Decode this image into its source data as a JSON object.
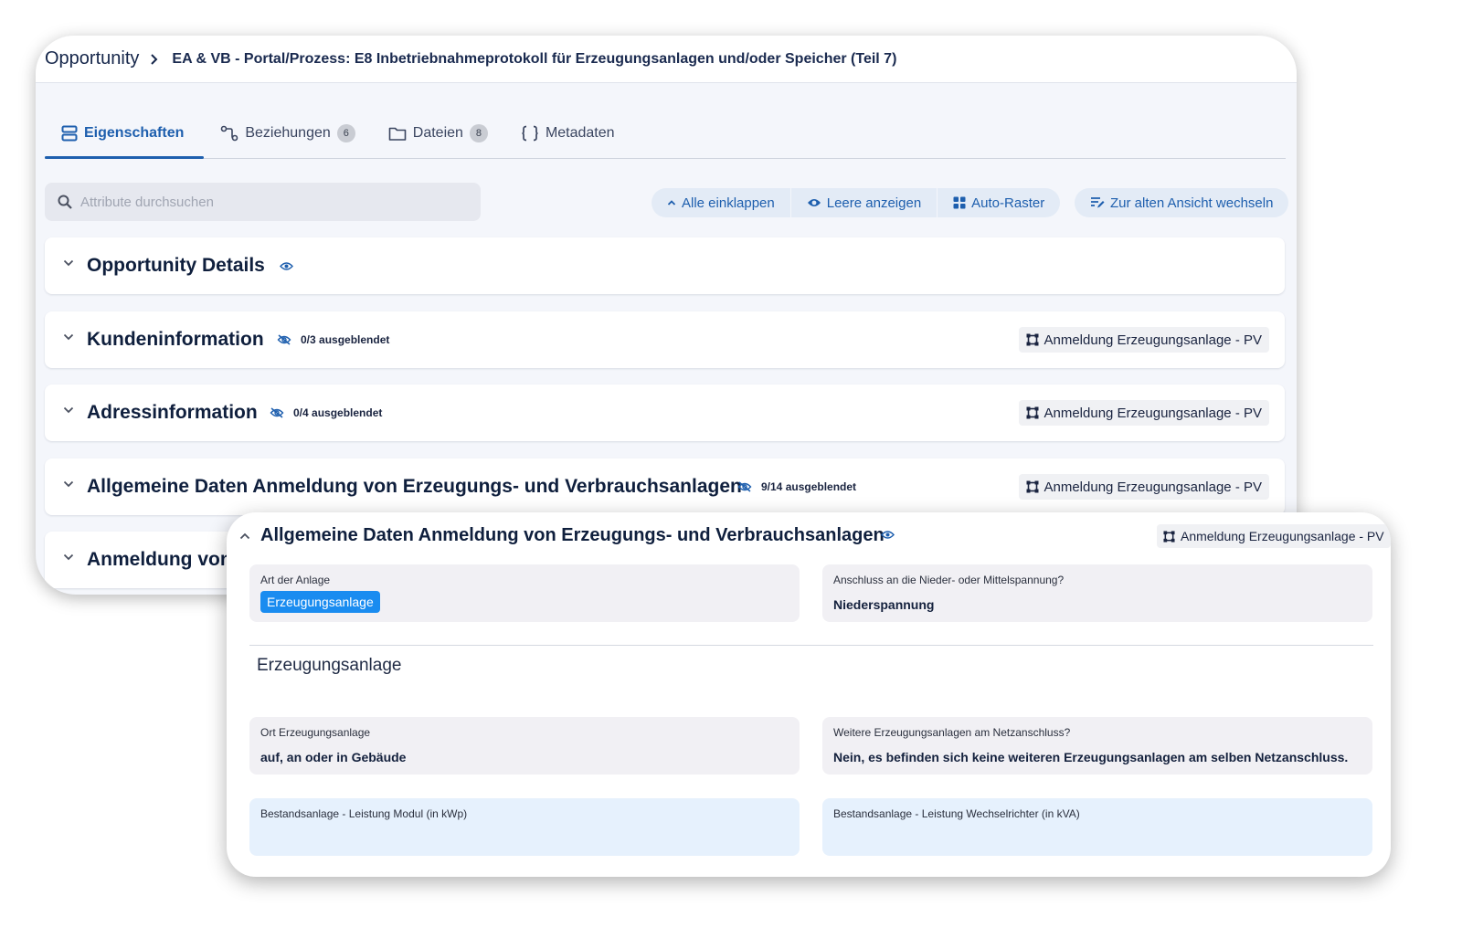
{
  "breadcrumb": {
    "root": "Opportunity",
    "current": "EA & VB - Portal/Prozess: E8 Inbetriebnahmeprotokoll für Erzeugungsanlagen und/oder Speicher (Teil 7)"
  },
  "tabs": [
    {
      "label": "Eigenschaften",
      "icon": "properties-icon",
      "active": true
    },
    {
      "label": "Beziehungen",
      "icon": "relations-icon",
      "badge": "6"
    },
    {
      "label": "Dateien",
      "icon": "folder-icon",
      "badge": "8"
    },
    {
      "label": "Metadaten",
      "icon": "braces-icon"
    }
  ],
  "search": {
    "placeholder": "Attribute durchsuchen"
  },
  "toolbar": {
    "collapse_all": "Alle einklappen",
    "show_empty": "Leere anzeigen",
    "auto_grid": "Auto-Raster",
    "switch_view": "Zur alten Ansicht wechseln"
  },
  "sections": [
    {
      "title": "Opportunity Details",
      "hidden": "",
      "tag": ""
    },
    {
      "title": "Kundeninformation",
      "hidden": "0/3 ausgeblendet",
      "tag": "Anmeldung Erzeugungsanlage - PV"
    },
    {
      "title": "Adressinformation",
      "hidden": "0/4 ausgeblendet",
      "tag": "Anmeldung Erzeugungsanlage - PV"
    },
    {
      "title": "Allgemeine Daten Anmeldung von Erzeugungs- und Verbrauchsanlagen",
      "hidden": "9/14 ausgeblendet",
      "tag": "Anmeldung Erzeugungsanlage - PV"
    },
    {
      "title": "Anmeldung von"
    }
  ],
  "detail": {
    "title": "Allgemeine Daten Anmeldung von Erzeugungs- und Verbrauchsanlagen",
    "tag": "Anmeldung Erzeugungsanlage - PV",
    "fields": {
      "art_label": "Art der Anlage",
      "art_value": "Erzeugungsanlage",
      "anschluss_label": "Anschluss an die Nieder- oder Mittelspannung?",
      "anschluss_value": "Niederspannung",
      "ort_label": "Ort Erzeugungsanlage",
      "ort_value": "auf, an oder in Gebäude",
      "weitere_label": "Weitere Erzeugungsanlagen am Netzanschluss?",
      "weitere_value": "Nein, es befinden sich keine weiteren Erzeugungsanlagen am selben Netzanschluss.",
      "modul_label": "Bestandsanlage - Leistung Modul (in kWp)",
      "wechselrichter_label": "Bestandsanlage - Leistung Wechselrichter (in kVA)"
    },
    "subheading": "Erzeugungsanlage"
  },
  "colors": {
    "accent": "#1e5fae",
    "chip": "#1a8cf0",
    "field_bg": "#f1f0f4",
    "field_blue_bg": "#e6f1fd"
  }
}
